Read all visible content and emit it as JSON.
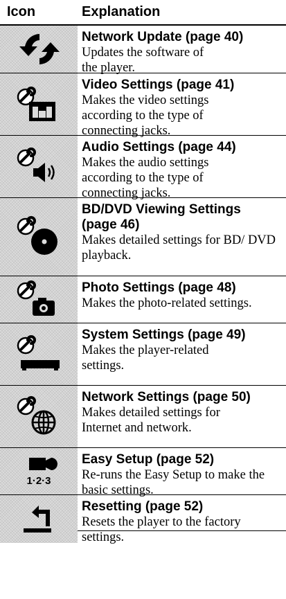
{
  "header": {
    "icon_col": "Icon",
    "explanation_col": "Explanation"
  },
  "rows": [
    {
      "icon": "network-update-icon",
      "title": "Network Update (page 40)",
      "desc": "Updates the software of the player."
    },
    {
      "icon": "video-settings-icon",
      "title": "Video Settings (page 41)",
      "desc": "Makes the video settings according to the type of connecting jacks."
    },
    {
      "icon": "audio-settings-icon",
      "title": "Audio Settings (page 44)",
      "desc": "Makes the audio settings according to the type of connecting jacks."
    },
    {
      "icon": "bd-dvd-viewing-settings-icon",
      "title": "BD/DVD Viewing Settings (page 46)",
      "desc": "Makes detailed settings for BD/ DVD playback."
    },
    {
      "icon": "photo-settings-icon",
      "title": "Photo Settings (page 48)",
      "desc": "Makes the photo-related settings."
    },
    {
      "icon": "system-settings-icon",
      "title": "System Settings (page 49)",
      "desc": "Makes the player-related settings."
    },
    {
      "icon": "network-settings-icon",
      "title": "Network Settings (page 50)",
      "desc": "Makes detailed settings for Internet and network."
    },
    {
      "icon": "easy-setup-icon",
      "icon_text": "1·2·3",
      "title": "Easy Setup (page 52)",
      "desc": "Re-runs the Easy Setup to make the basic settings."
    },
    {
      "icon": "resetting-icon",
      "title": "Resetting (page 52)",
      "desc": "Resets the player to the factory settings."
    }
  ]
}
